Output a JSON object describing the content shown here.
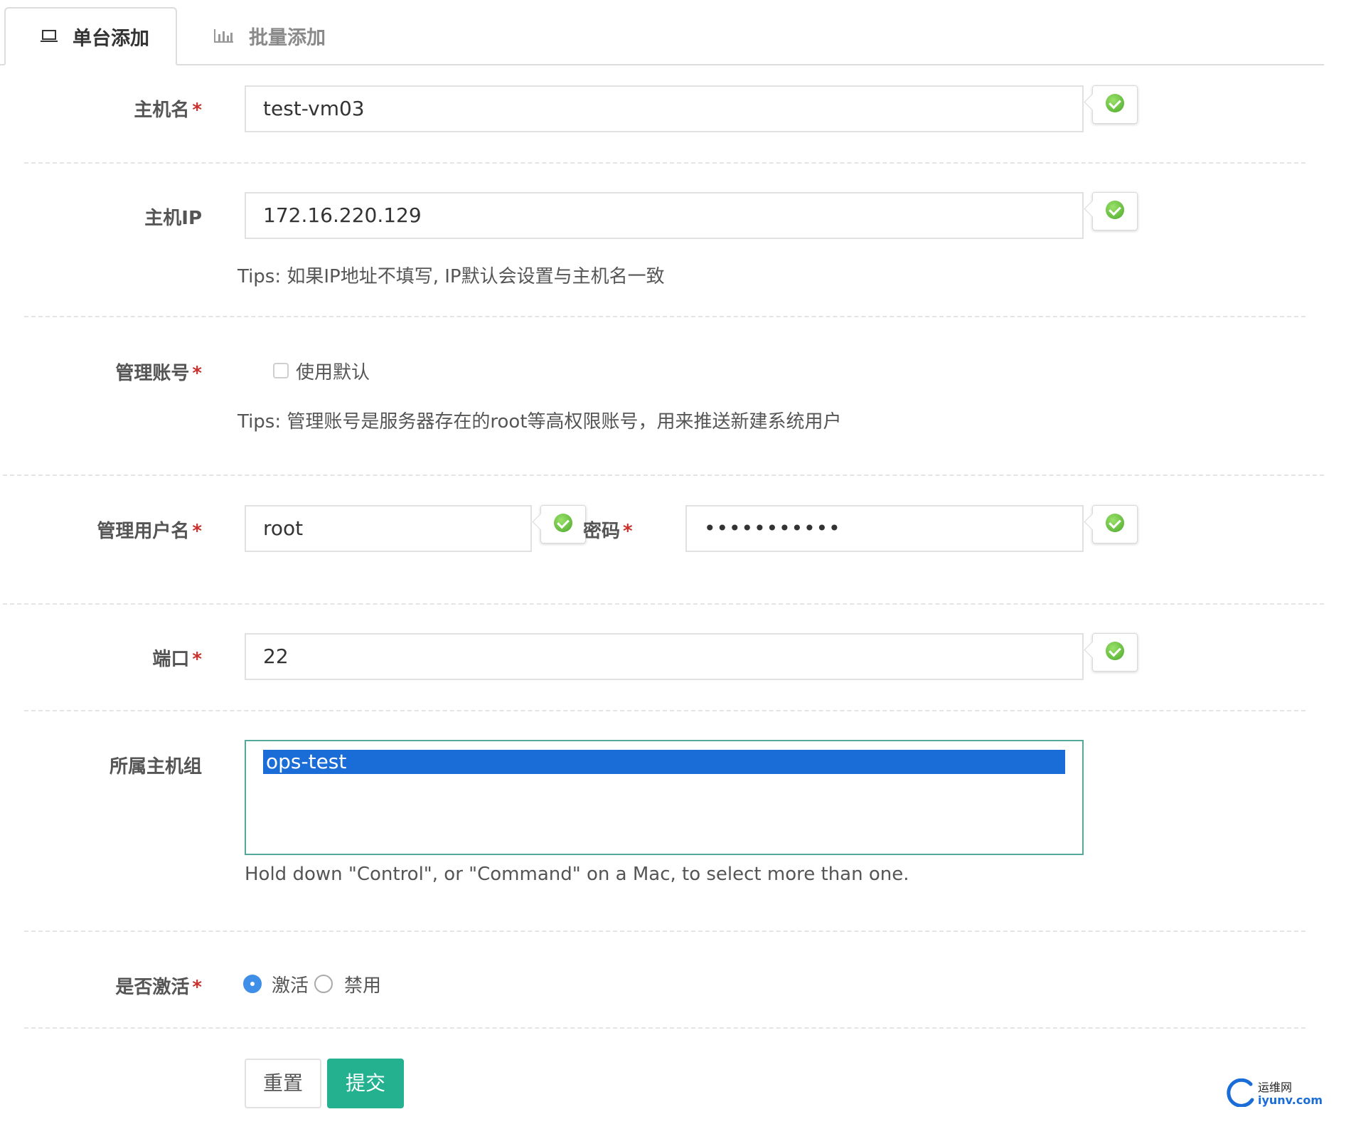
{
  "tabs": {
    "single": "单台添加",
    "batch": "批量添加"
  },
  "form": {
    "hostname": {
      "label": "主机名",
      "required": "*",
      "value": "test-vm03"
    },
    "hostip": {
      "label": "主机IP",
      "value": "172.16.220.129",
      "tip": "Tips: 如果IP地址不填写, IP默认会设置与主机名一致"
    },
    "admin_account": {
      "label": "管理账号",
      "required": "*",
      "checkbox_label": "使用默认",
      "checked": false,
      "tip": "Tips: 管理账号是服务器存在的root等高权限账号，用来推送新建系统用户"
    },
    "admin_user": {
      "label": "管理用户名",
      "required": "*",
      "value": "root"
    },
    "password": {
      "label": "密码",
      "required": "*",
      "value": "•••••••••••"
    },
    "port": {
      "label": "端口",
      "required": "*",
      "value": "22"
    },
    "host_group": {
      "label": "所属主机组",
      "options": [
        "ops-test"
      ],
      "selected": "ops-test",
      "help": "Hold down \"Control\", or \"Command\" on a Mac, to select more than one."
    },
    "active": {
      "label": "是否激活",
      "required": "*",
      "options": [
        "激活",
        "禁用"
      ],
      "selected": "激活"
    }
  },
  "buttons": {
    "reset": "重置",
    "submit": "提交"
  },
  "watermark": {
    "cn": "运维网",
    "domain": "iyunv.com"
  },
  "colors": {
    "accent": "#23b190",
    "required": "#c9302c",
    "selection": "#1a6dd6",
    "radio": "#3f8ee8",
    "valid": "#4aa82a"
  }
}
